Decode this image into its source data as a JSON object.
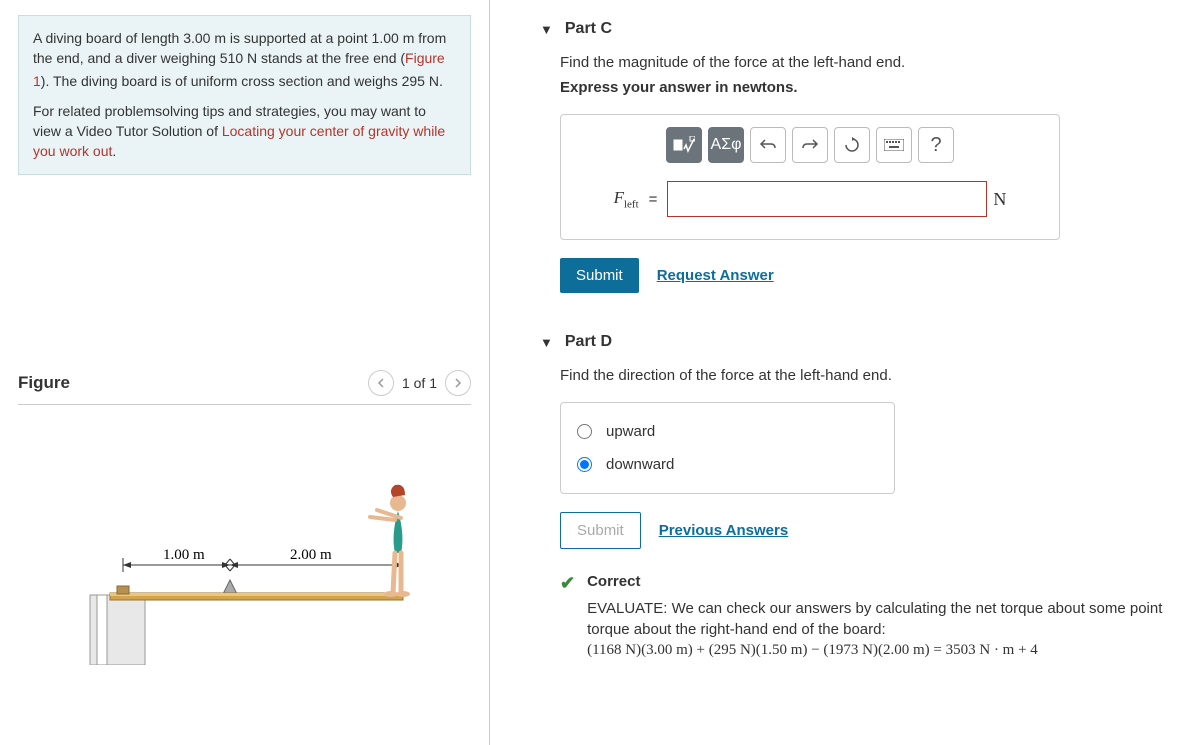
{
  "problem": {
    "text_before_fig": "A diving board of length 3.00 m is supported at a point 1.00 m from the end, and a diver weighing 510 N stands at the free end (",
    "figure_link": "Figure 1",
    "text_after_fig": "). The diving board is of uniform cross section and weighs 295 N.",
    "tips_before_link": "For related problemsolving tips and strategies, you may want to view a Video Tutor Solution of ",
    "tips_link": "Locating your center of gravity while you work out",
    "tips_after_link": "."
  },
  "figure": {
    "label": "Figure",
    "counter": "1 of 1",
    "dim1": "1.00 m",
    "dim2": "2.00 m"
  },
  "partC": {
    "title": "Part C",
    "prompt": "Find the magnitude of the force at the left-hand end.",
    "instruct": "Express your answer in newtons.",
    "lhs_var": "F",
    "lhs_sub": "left",
    "unit": "N",
    "toolbar": {
      "templates": "■√x",
      "greek": "ΑΣφ"
    },
    "submit": "Submit",
    "request": "Request Answer"
  },
  "partD": {
    "title": "Part D",
    "prompt": "Find the direction of the force at the left-hand end.",
    "opt1": "upward",
    "opt2": "downward",
    "submit": "Submit",
    "prev": "Previous Answers",
    "correct": "Correct",
    "evaluate": "EVALUATE: We can check our answers by calculating the net torque about some point torque about the right-hand end of the board:",
    "equation": "(1168 N)(3.00 m) + (295 N)(1.50 m) − (1973 N)(2.00 m) = 3503 N · m + 4"
  }
}
